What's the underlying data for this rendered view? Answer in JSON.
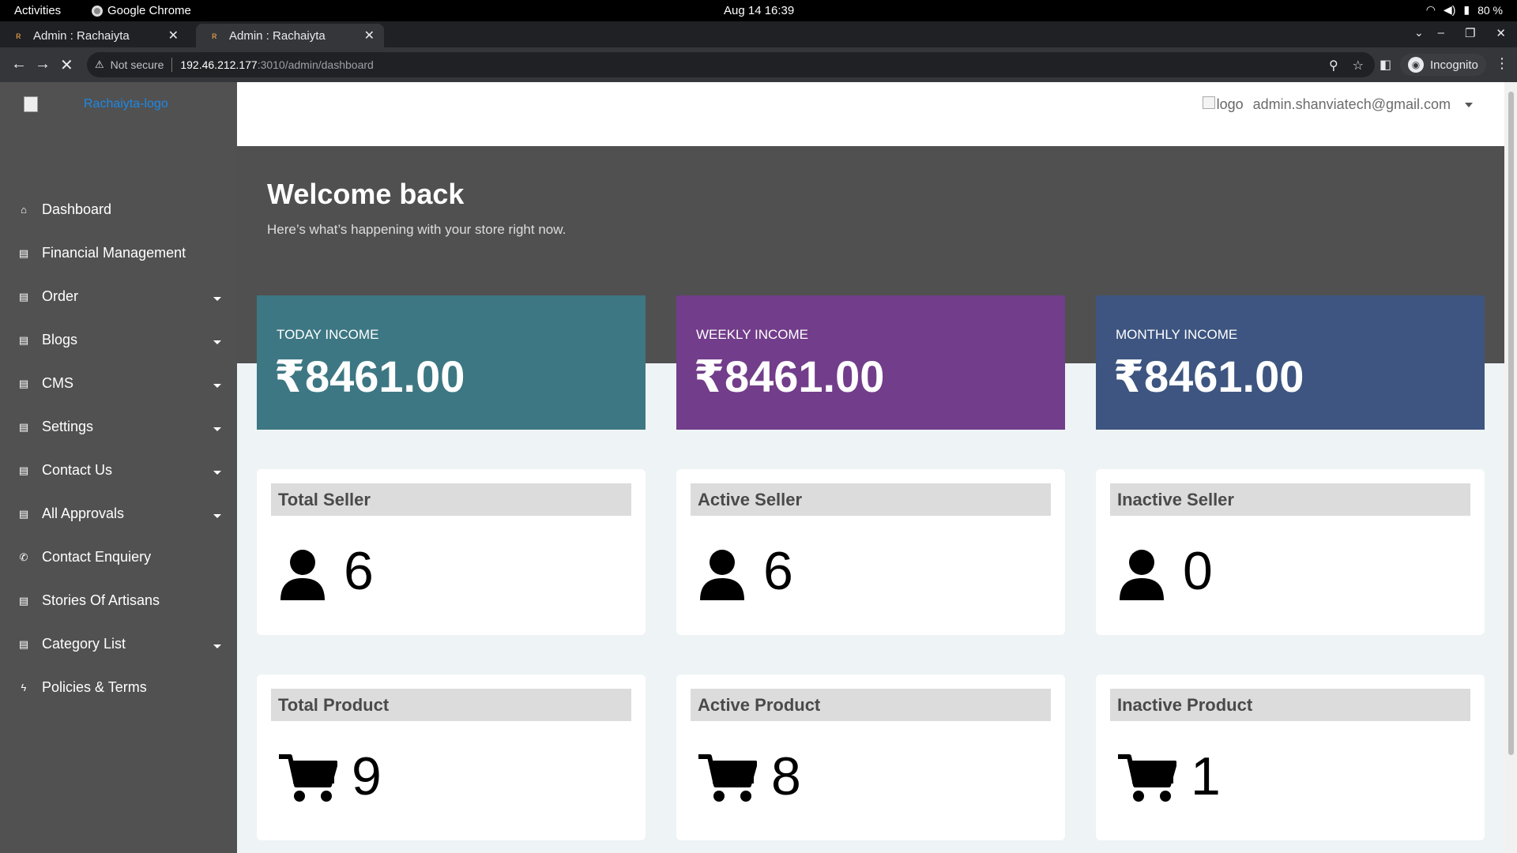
{
  "os": {
    "activities": "Activities",
    "app_name": "Google Chrome",
    "clock": "Aug 14  16:39",
    "battery": "80 %"
  },
  "browser": {
    "tabs": [
      {
        "title": "Admin : Rachaiyta",
        "active": false
      },
      {
        "title": "Admin : Rachaiyta",
        "active": true
      }
    ],
    "address": {
      "security": "Not secure",
      "host": "192.46.212.177",
      "path": ":3010/admin/dashboard"
    },
    "profile": "Incognito"
  },
  "sidebar": {
    "logo_alt": "Rachaiyta-logo",
    "items": [
      {
        "label": "Dashboard",
        "icon": "home-icon",
        "glyph": "⌂",
        "has_caret": false
      },
      {
        "label": "Financial Management",
        "icon": "list-icon",
        "glyph": "▤",
        "has_caret": false
      },
      {
        "label": "Order",
        "icon": "list-icon",
        "glyph": "▤",
        "has_caret": true
      },
      {
        "label": "Blogs",
        "icon": "list-icon",
        "glyph": "▤",
        "has_caret": true
      },
      {
        "label": "CMS",
        "icon": "list-icon",
        "glyph": "▤",
        "has_caret": true
      },
      {
        "label": "Settings",
        "icon": "list-icon",
        "glyph": "▤",
        "has_caret": true
      },
      {
        "label": "Contact Us",
        "icon": "list-icon",
        "glyph": "▤",
        "has_caret": true
      },
      {
        "label": "All Approvals",
        "icon": "list-icon",
        "glyph": "▤",
        "has_caret": true
      },
      {
        "label": "Contact Enquiery",
        "icon": "phone-icon",
        "glyph": "✆",
        "has_caret": false
      },
      {
        "label": "Stories Of Artisans",
        "icon": "list-icon",
        "glyph": "▤",
        "has_caret": false
      },
      {
        "label": "Category List",
        "icon": "list-icon",
        "glyph": "▤",
        "has_caret": true
      },
      {
        "label": "Policies & Terms",
        "icon": "bolt-icon",
        "glyph": "ϟ",
        "has_caret": false
      }
    ]
  },
  "header": {
    "user_logo_alt": "logo",
    "user_email": "admin.shanviatech@gmail.com"
  },
  "banner": {
    "title": "Welcome back",
    "subtitle": "Here’s what’s happening with your store right now."
  },
  "income": [
    {
      "label": "TODAY INCOME",
      "amount": "₹8461.00",
      "color": "#3d7783"
    },
    {
      "label": "WEEKLY INCOME",
      "amount": "₹8461.00",
      "color": "#723d8a"
    },
    {
      "label": "MONTHLY INCOME",
      "amount": "₹8461.00",
      "color": "#3d5580"
    }
  ],
  "sellers": [
    {
      "title": "Total Seller",
      "value": "6"
    },
    {
      "title": "Active Seller",
      "value": "6"
    },
    {
      "title": "Inactive Seller",
      "value": "0"
    }
  ],
  "products": [
    {
      "title": "Total Product",
      "value": "9"
    },
    {
      "title": "Active Product",
      "value": "8"
    },
    {
      "title": "Inactive Product",
      "value": "1"
    }
  ]
}
